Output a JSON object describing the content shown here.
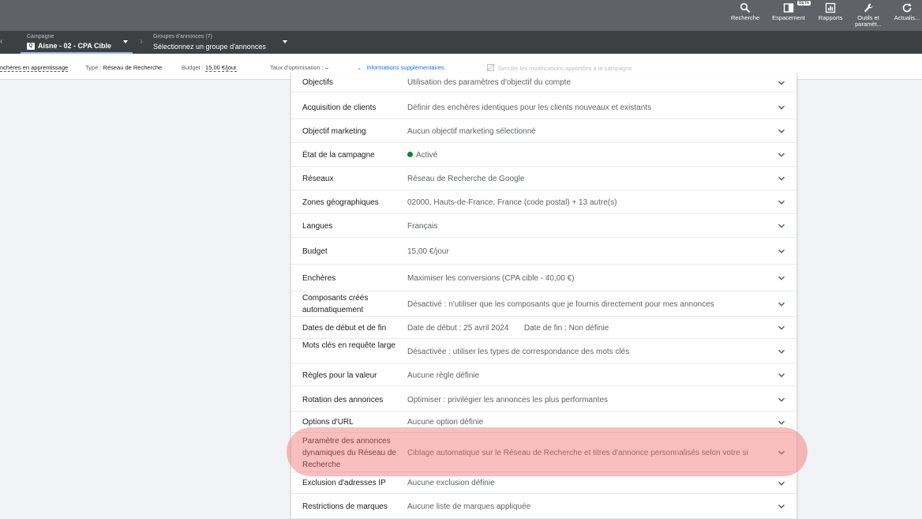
{
  "header": {
    "tools": [
      {
        "label": "Recherche",
        "icon": "search-icon"
      },
      {
        "label": "Espacement",
        "icon": "appearance-icon",
        "badge": "BÊTA"
      },
      {
        "label": "Rapports",
        "icon": "reports-icon"
      },
      {
        "label": "Outils et paramèt...",
        "icon": "wrench-icon"
      },
      {
        "label": "Actualis...",
        "icon": "refresh-icon"
      }
    ]
  },
  "campaign_bar": {
    "campaign_label": "Campagne",
    "campaign_name": "Aisne - 02 - CPA Cible",
    "campaign_badge": "Q",
    "adgroup_label": "Groupes d'annonces (7)",
    "adgroup_value": "Sélectionnez un groupe d'annonces"
  },
  "info_bar": {
    "bidding_status": "nchères en apprentissage",
    "type_label": "Type :",
    "type_value": "Réseau de Recherche",
    "budget_label": "Budget :",
    "budget_value": "15,00 €/jour",
    "optimization_label": "Taux d'optimisation :",
    "optimization_value": "–",
    "more_info": "Informations supplémentaires",
    "simulate": "Simuler les modifications apportées à la campagne"
  },
  "settings": [
    {
      "name": "Objectifs",
      "value": "Utilisation des paramètres d'objectif du compte"
    },
    {
      "name": "Acquisition de clients",
      "value": "Définir des enchères identiques pour les clients nouveaux et existants"
    },
    {
      "name": "Objectif marketing",
      "value": "Aucun objectif marketing sélectionné"
    },
    {
      "name": "État de la campagne",
      "value": "Activé"
    },
    {
      "name": "Réseaux",
      "value": "Réseau de Recherche de Google"
    },
    {
      "name": "Zones géographiques",
      "value": "02000, Hauts-de-France, France (code postal) + 13 autre(s)"
    },
    {
      "name": "Langues",
      "value": "Français"
    },
    {
      "name": "Budget",
      "value": "15,00 €/jour"
    },
    {
      "name": "Enchères",
      "value": "Maximiser les conversions (CPA cible - 40,00 €)"
    },
    {
      "name": "Composants créés automatiquement",
      "value": "Désactivé : n'utiliser que les composants que je fournis directement pour mes annonces"
    },
    {
      "name": "Dates de début et de fin",
      "value": "Date de début : 25 avril 2024       Date de fin : Non définie"
    },
    {
      "name": "Mots clés en requête large",
      "value": "Désactivée : utiliser les types de correspondance des mots clés"
    },
    {
      "name": "Règles pour la valeur",
      "value": "Aucune règle définie"
    },
    {
      "name": "Rotation des annonces",
      "value": "Optimiser : privilégier les annonces les plus performantes"
    },
    {
      "name": "Options d'URL",
      "value": "Aucune option définie"
    },
    {
      "name": "Paramètre des annonces dynamiques du Réseau de Recherche",
      "value": "Ciblage automatique sur le Réseau de Recherche et titres d'annonce personnalisés selon votre si"
    },
    {
      "name": "Exclusion d'adresses IP",
      "value": "Aucune exclusion définie"
    },
    {
      "name": "Restrictions de marques",
      "value": "Aucune liste de marques appliquée"
    }
  ],
  "colors": {
    "header_bg": "#5f6368",
    "campaign_bar_bg": "#3c4043",
    "accent_blue": "#1a73e8",
    "active_green": "#188038",
    "highlight": "#f16e6e"
  }
}
